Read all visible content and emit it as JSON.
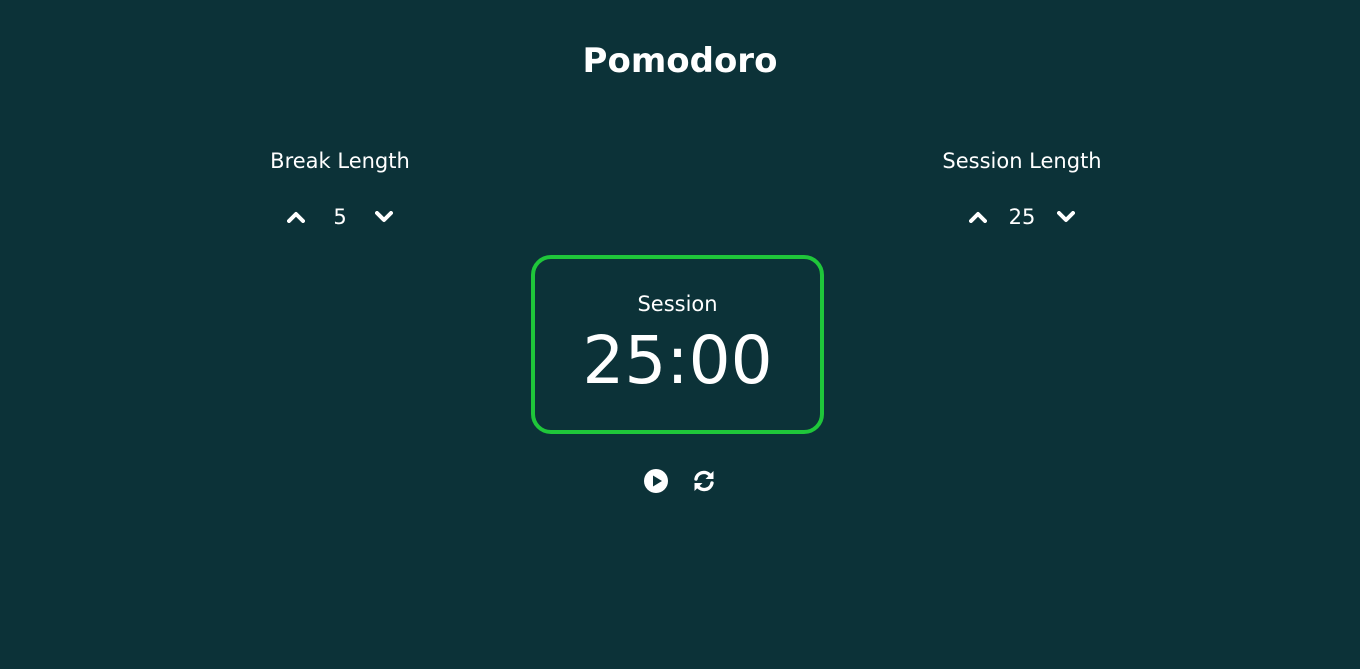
{
  "app": {
    "title": "Pomodoro"
  },
  "break": {
    "label": "Break Length",
    "value": "5",
    "increment_icon": "chevron-up-icon",
    "decrement_icon": "chevron-down-icon"
  },
  "session": {
    "label": "Session Length",
    "value": "25",
    "increment_icon": "chevron-up-icon",
    "decrement_icon": "chevron-down-icon"
  },
  "timer": {
    "label": "Session",
    "time": "25:00",
    "border_color": "#1fc63a"
  },
  "playback": {
    "start_icon": "play-circle-icon",
    "reset_icon": "refresh-icon"
  },
  "colors": {
    "background": "#0c3238",
    "text": "#ffffff",
    "accent": "#1fc63a"
  }
}
